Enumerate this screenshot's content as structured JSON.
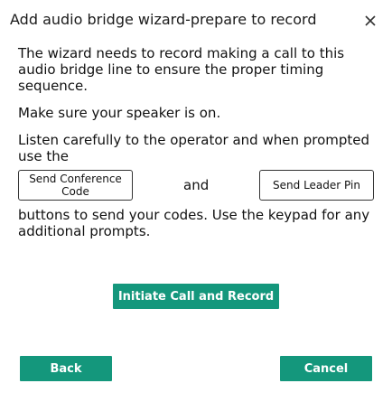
{
  "dialog": {
    "title": "Add audio bridge wizard-prepare to record",
    "close_icon": "close-icon"
  },
  "content": {
    "intro": "The wizard needs to record making a call to this audio bridge line to ensure the proper timing sequence.",
    "speaker_note": "Make sure your speaker is on.",
    "listen_text": "Listen carefully to the operator and when prompted use the",
    "send_conference_label": "Send Conference Code",
    "and_text": "and",
    "send_leader_label": "Send Leader Pin",
    "buttons_text": "buttons to send your codes. Use the keypad for any additional prompts."
  },
  "actions": {
    "initiate_label": "Initiate Call and Record",
    "back_label": "Back",
    "cancel_label": "Cancel"
  },
  "colors": {
    "accent": "#14977c"
  }
}
